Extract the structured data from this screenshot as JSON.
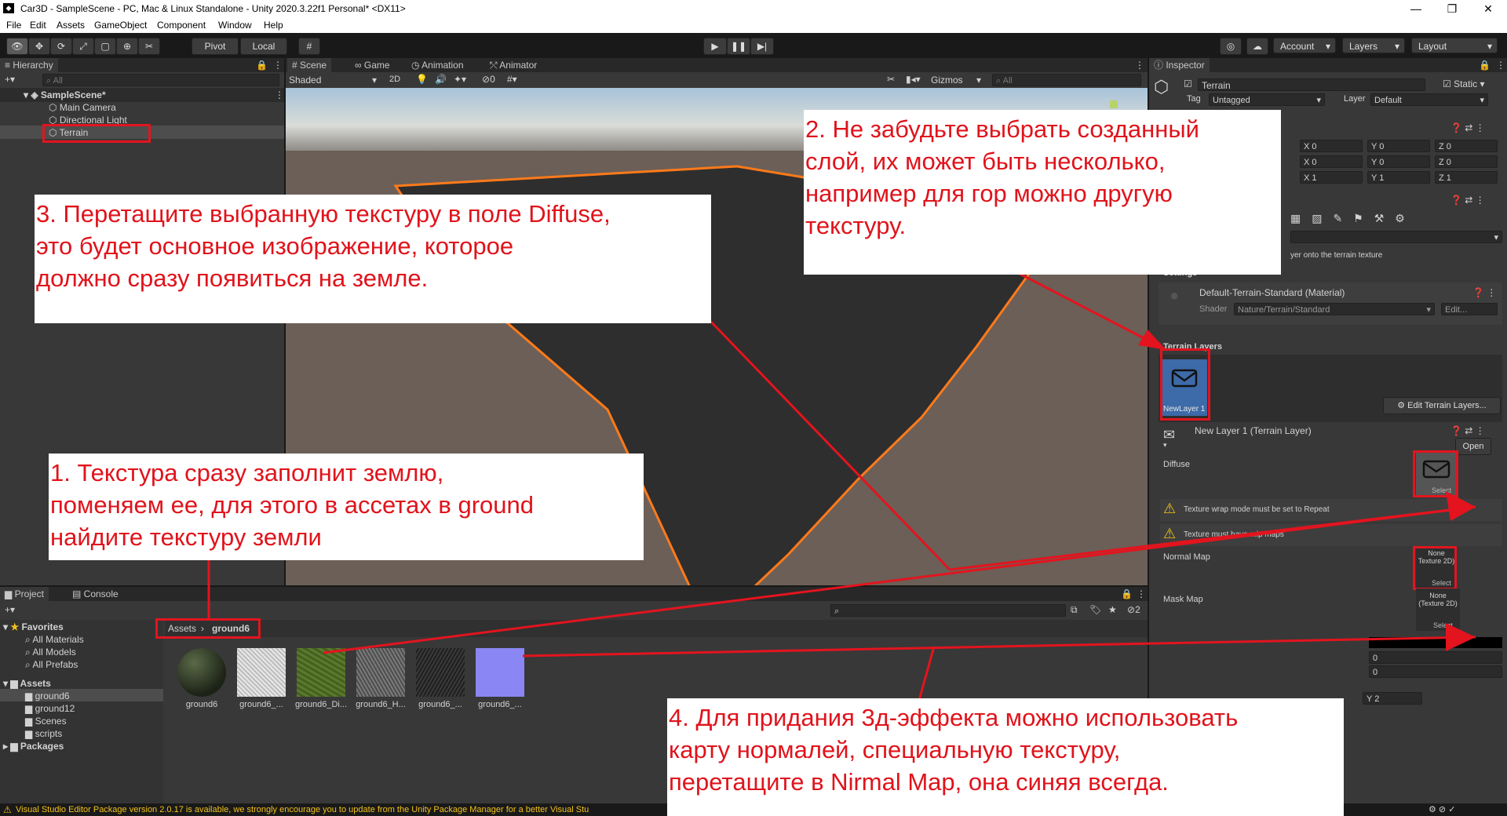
{
  "window": {
    "title": "Car3D - SampleScene - PC, Mac & Linux Standalone - Unity 2020.3.22f1 Personal* <DX11>",
    "controls": [
      "—",
      "❐",
      "✕"
    ]
  },
  "menu": [
    "File",
    "Edit",
    "Assets",
    "GameObject",
    "Component",
    "Window",
    "Help"
  ],
  "toolbar": {
    "pivot": "Pivot",
    "local": "Local",
    "account": "Account",
    "layers": "Layers",
    "layout": "Layout"
  },
  "hierarchy": {
    "tab": "Hierarchy",
    "search_placeholder": "All",
    "scene": "SampleScene*",
    "items": [
      "Main Camera",
      "Directional Light",
      "Terrain"
    ]
  },
  "scene_view": {
    "tabs": [
      "Scene",
      "Game",
      "Animation",
      "Animator"
    ],
    "shading": "Shaded",
    "mode_2d": "2D",
    "hidden_count": "0",
    "gizmos": "Gizmos",
    "search_placeholder": "All"
  },
  "project": {
    "tabs": [
      "Project",
      "Console"
    ],
    "breadcrumb": [
      "Assets",
      "ground6"
    ],
    "favorites_label": "Favorites",
    "favorites": [
      "All Materials",
      "All Models",
      "All Prefabs"
    ],
    "assets_label": "Assets",
    "folders": [
      "ground6",
      "ground12",
      "Scenes",
      "scripts"
    ],
    "packages_label": "Packages",
    "hidden_count": "2",
    "assets": [
      {
        "name": "ground6",
        "color": "#2c3a22"
      },
      {
        "name": "ground6_...",
        "color": "#d8d8d8"
      },
      {
        "name": "ground6_Di...",
        "color": "#5b7a2e"
      },
      {
        "name": "ground6_H...",
        "color": "#6a6a6a"
      },
      {
        "name": "ground6_...",
        "color": "#2e2e2e"
      },
      {
        "name": "ground6_...",
        "color": "#8a86f4"
      }
    ]
  },
  "status_bar": "Visual Studio Editor Package version 2.0.17 is available, we strongly encourage you to update from the Unity Package Manager for a better Visual Stu",
  "inspector": {
    "tab": "Inspector",
    "object_name": "Terrain",
    "static_label": "Static",
    "tag_label": "Tag",
    "tag_value": "Untagged",
    "layer_label": "Layer",
    "layer_value": "Default",
    "transform": {
      "position": {
        "x": "0",
        "y": "0",
        "z": "0"
      },
      "rotation": {
        "x": "0",
        "y": "0",
        "z": "0"
      },
      "scale": {
        "x": "1",
        "y": "1",
        "z": "1"
      }
    },
    "paint_hint": "yer onto the terrain texture",
    "settings_label": "Settings",
    "material": "Default-Terrain-Standard (Material)",
    "shader_label": "Shader",
    "shader_value": "Nature/Terrain/Standard",
    "edit_label": "Edit...",
    "terrain_layers_label": "Terrain Layers",
    "layer_tile": "NewLayer 1",
    "edit_layers_button": "Edit Terrain Layers...",
    "layer_title": "New Layer 1 (Terrain Layer)",
    "open_button": "Open",
    "diffuse_label": "Diffuse",
    "select_label": "Select",
    "warning_wrap": "Texture wrap mode must be set to Repeat",
    "warning_mip": "Texture must have mip maps",
    "normal_map_label": "Normal Map",
    "normal_none": "None\nTexture 2D)",
    "mask_map_label": "Mask Map",
    "mask_none": "None\n(Texture 2D)",
    "field_zero_1": "0",
    "field_zero_2": "0",
    "y_label": "Y",
    "y_value": "2"
  },
  "annotations": {
    "a1": "1. Текстура сразу заполнит землю,\nпоменяем ее, для этого в ассетах в ground\nнайдите текстуру земли",
    "a2": "2. Не забудьте выбрать созданный\nслой, их может быть несколько,\nнапример для гор можно другую\nтекстуру.",
    "a3": "3. Перетащите выбранную текстуру в поле Diffuse,\nэто будет основное изображение, которое\nдолжно сразу появиться на земле.",
    "a4": "4. Для придания 3д-эффекта можно использовать\nкарту нормалей, специальную текстуру,\nперетащите в Nirmal Map, она синяя всегда."
  },
  "colors": {
    "annotation": "#e0131b",
    "terrain_edge": "#ff7a1a",
    "terrain_dark": "#2e2e2e",
    "terrain_brown": "#6b5f57",
    "normal_map": "#8a86f4"
  }
}
